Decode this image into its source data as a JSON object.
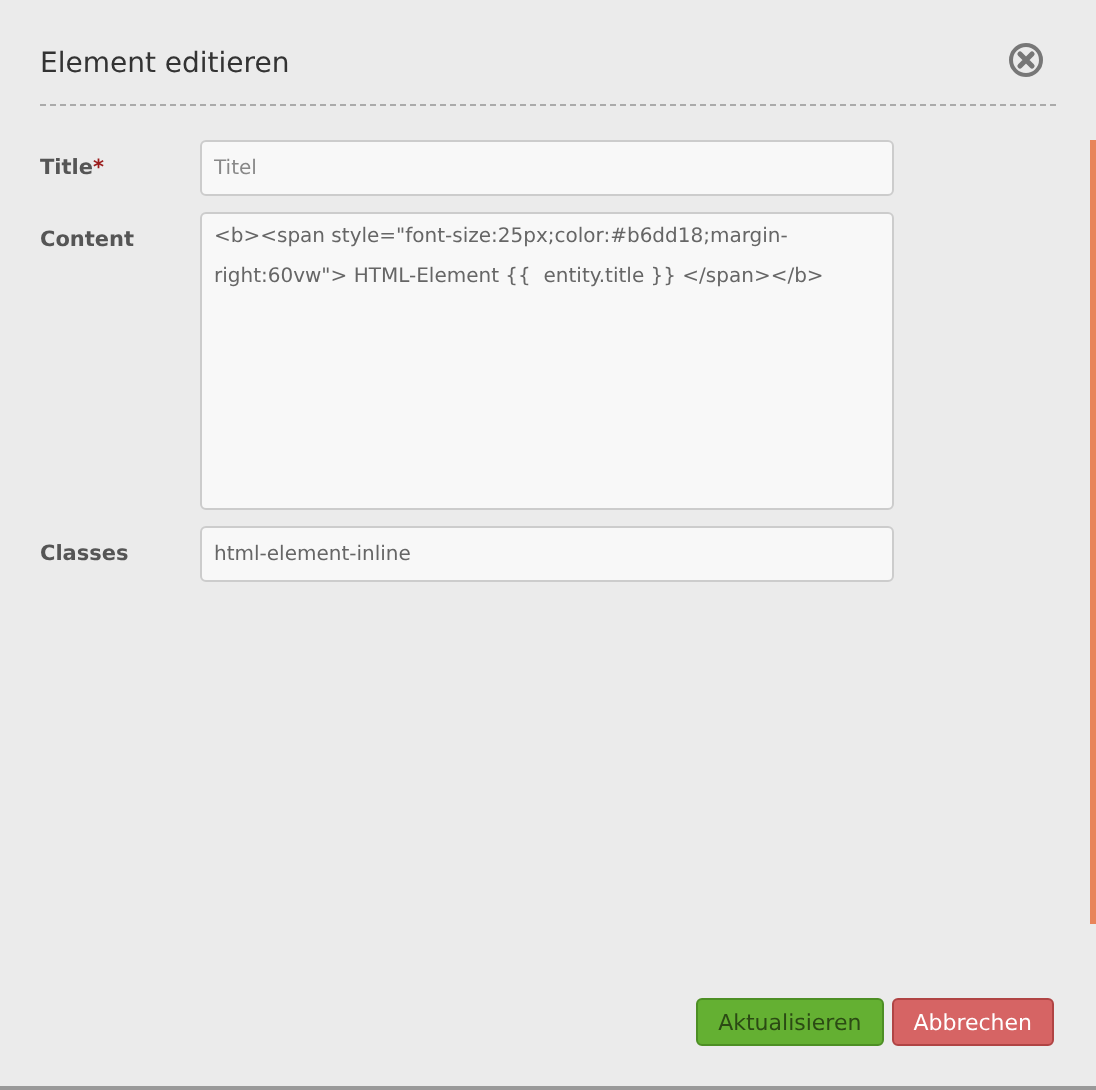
{
  "dialog": {
    "title": "Element editieren"
  },
  "fields": [
    {
      "kind": "input",
      "label": "Title",
      "required_mark": "*",
      "placeholder": "Titel"
    },
    {
      "kind": "textarea",
      "label": "Content",
      "value": "<b><span style=\"font-size:25px;color:#b6dd18;margin-right:60vw\"> HTML-Element {{  entity.title }} </span></b>"
    },
    {
      "kind": "input",
      "label": "Classes",
      "value": "html-element-inline"
    }
  ],
  "buttons": [
    {
      "kind": "primary",
      "label": "Aktualisieren"
    },
    {
      "kind": "danger",
      "label": "Abbrechen"
    }
  ]
}
